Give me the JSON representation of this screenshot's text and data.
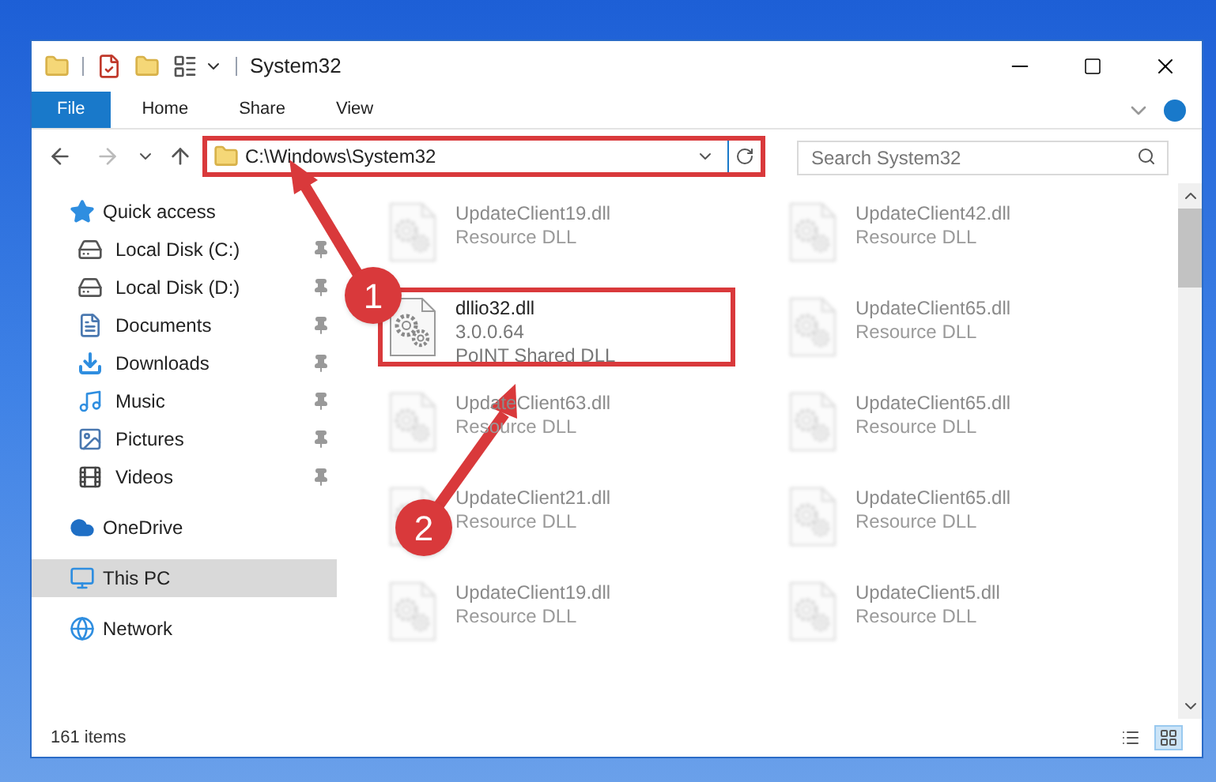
{
  "window": {
    "title": "System32"
  },
  "ribbon": {
    "tabs": [
      {
        "label": "File",
        "kind": "file"
      },
      {
        "label": "Home",
        "kind": "tab"
      },
      {
        "label": "Share",
        "kind": "tab"
      },
      {
        "label": "View",
        "kind": "tab"
      }
    ]
  },
  "navigation": {
    "back": {
      "disabled": false
    },
    "forward": {
      "disabled": true
    },
    "up": {
      "disabled": false
    }
  },
  "address_bar": {
    "path": "C:\\Windows\\System32",
    "highlighted": true
  },
  "search": {
    "placeholder": "Search System32"
  },
  "sidebar": {
    "items": [
      {
        "label": "Quick access",
        "selected": false,
        "children": [
          {
            "label": "Local Disk (C:)",
            "pinned": true
          },
          {
            "label": "Local Disk (D:)",
            "pinned": true
          },
          {
            "label": "Documents",
            "pinned": true
          },
          {
            "label": "Downloads",
            "pinned": true
          },
          {
            "label": "Music",
            "pinned": true
          },
          {
            "label": "Pictures",
            "pinned": true
          },
          {
            "label": "Videos",
            "pinned": true
          }
        ]
      },
      {
        "label": "OneDrive",
        "selected": false
      },
      {
        "label": "This PC",
        "selected": true
      },
      {
        "label": "Network",
        "selected": false
      }
    ]
  },
  "files": [
    {
      "name": "UpdateClient19.dll",
      "lines": [
        "Resource DLL"
      ],
      "highlighted": false
    },
    {
      "name": "UpdateClient42.dll",
      "lines": [
        "Resource DLL"
      ],
      "highlighted": false
    },
    {
      "name": "dllio32.dll",
      "lines": [
        "3.0.0.64",
        "PoINT Shared DLL"
      ],
      "highlighted": true
    },
    {
      "name": "UpdateClient65.dll",
      "lines": [
        "Resource DLL"
      ],
      "highlighted": false
    },
    {
      "name": "UpdateClient63.dll",
      "lines": [
        "Resource DLL"
      ],
      "highlighted": false
    },
    {
      "name": "UpdateClient65.dll",
      "lines": [
        "Resource DLL"
      ],
      "highlighted": false
    },
    {
      "name": "UpdateClient21.dll",
      "lines": [
        "Resource DLL"
      ],
      "highlighted": false
    },
    {
      "name": "UpdateClient65.dll",
      "lines": [
        "Resource DLL"
      ],
      "highlighted": false
    },
    {
      "name": "UpdateClient19.dll",
      "lines": [
        "Resource DLL"
      ],
      "highlighted": false
    },
    {
      "name": "UpdateClient5.dll",
      "lines": [
        "Resource DLL"
      ],
      "highlighted": false
    }
  ],
  "status_bar": {
    "item_count": "161 items",
    "views": [
      {
        "kind": "details",
        "selected": false
      },
      {
        "kind": "large_icons",
        "selected": true
      }
    ]
  },
  "annotations": [
    {
      "number": "1"
    },
    {
      "number": "2"
    }
  ]
}
